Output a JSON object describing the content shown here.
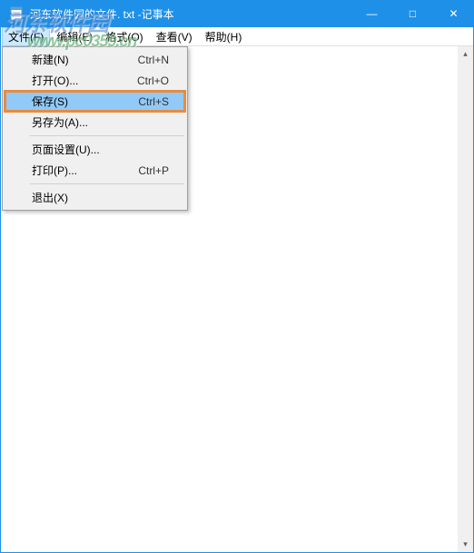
{
  "window": {
    "title": "河东软件园的文件. txt -记事本"
  },
  "sysbuttons": {
    "min": "—",
    "max": "□",
    "close": "✕"
  },
  "menubar": [
    {
      "label": "文件(F)",
      "open": true
    },
    {
      "label": "编辑(E)"
    },
    {
      "label": "格式(O)"
    },
    {
      "label": "查看(V)"
    },
    {
      "label": "帮助(H)"
    }
  ],
  "dropdown": [
    {
      "label": "新建(N)",
      "shortcut": "Ctrl+N"
    },
    {
      "label": "打开(O)...",
      "shortcut": "Ctrl+O"
    },
    {
      "label": "保存(S)",
      "shortcut": "Ctrl+S",
      "highlight": true
    },
    {
      "label": "另存为(A)...",
      "shortcut": ""
    },
    {
      "sep": true
    },
    {
      "label": "页面设置(U)...",
      "shortcut": ""
    },
    {
      "label": "打印(P)...",
      "shortcut": "Ctrl+P"
    },
    {
      "sep": true
    },
    {
      "label": "退出(X)",
      "shortcut": ""
    }
  ],
  "watermark": {
    "line1": "河东软件园",
    "line2": "www.pc0359.cn"
  },
  "scroll": {
    "up": "▴",
    "down": "▾"
  }
}
